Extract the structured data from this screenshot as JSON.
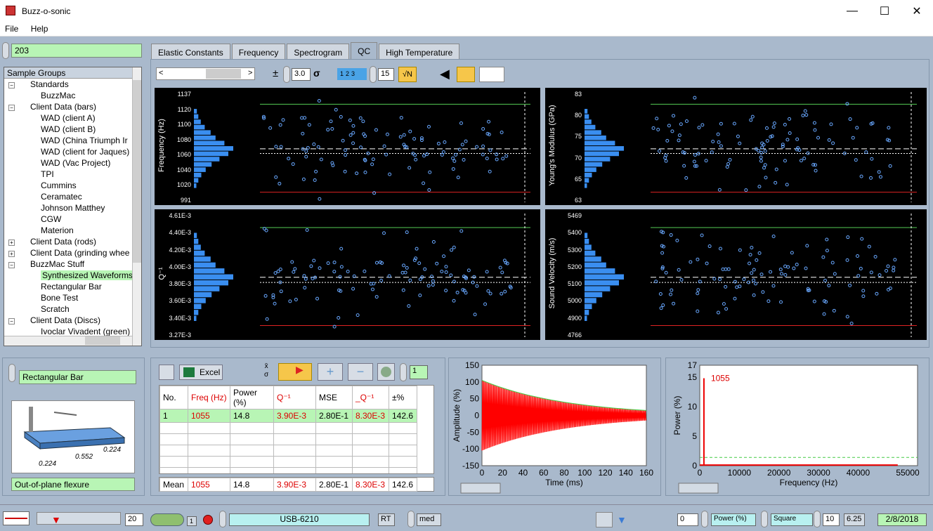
{
  "window": {
    "title": "Buzz-o-sonic",
    "minimize": "—",
    "maximize": "☐",
    "close": "✕"
  },
  "menu": [
    "File",
    "Help"
  ],
  "sample_id": "203",
  "tree": {
    "header": "Sample Groups",
    "rows": [
      {
        "label": "Standards",
        "level": 0,
        "exp": "−"
      },
      {
        "label": "BuzzMac",
        "level": 1
      },
      {
        "label": "Client Data (bars)",
        "level": 0,
        "exp": "−"
      },
      {
        "label": "WAD (client A)",
        "level": 1
      },
      {
        "label": "WAD (client B)",
        "level": 1
      },
      {
        "label": "WAD (China Triumph Ir",
        "level": 1
      },
      {
        "label": "WAD (client for Jaques)",
        "level": 1
      },
      {
        "label": "WAD (Vac Project)",
        "level": 1
      },
      {
        "label": "TPI",
        "level": 1
      },
      {
        "label": "Cummins",
        "level": 1
      },
      {
        "label": "Ceramatec",
        "level": 1
      },
      {
        "label": "Johnson Matthey",
        "level": 1
      },
      {
        "label": "CGW",
        "level": 1
      },
      {
        "label": "Materion",
        "level": 1
      },
      {
        "label": "Client Data (rods)",
        "level": 0,
        "exp": "+"
      },
      {
        "label": "Client Data (grinding whee",
        "level": 0,
        "exp": "+"
      },
      {
        "label": "BuzzMac Stuff",
        "level": 0,
        "exp": "−"
      },
      {
        "label": "Synthesized Waveforms",
        "level": 1,
        "selected": true
      },
      {
        "label": "Rectangular Bar",
        "level": 1
      },
      {
        "label": "Bone Test",
        "level": 1
      },
      {
        "label": "Scratch",
        "level": 1
      },
      {
        "label": "Client Data (Discs)",
        "level": 0,
        "exp": "−"
      },
      {
        "label": "Ivoclar Vivadent (green)",
        "level": 1
      }
    ]
  },
  "tabs": [
    "Elastic Constants",
    "Frequency",
    "Spectrogram",
    "QC",
    "High Temperature"
  ],
  "active_tab": "QC",
  "qc_toolbar": {
    "pm": "±",
    "sigma_value": "3.0",
    "sigma": "σ",
    "count": "15",
    "sqrtn": "√N",
    "bins": "123"
  },
  "qc_plots": [
    {
      "ylabel": "Frequency (Hz)",
      "ticks": [
        "1137",
        "1120",
        "1100",
        "1080",
        "1060",
        "1040",
        "1020",
        "991"
      ]
    },
    {
      "ylabel": "Young's Modulus (GPa)",
      "ticks": [
        "83",
        "80",
        "75",
        "70",
        "65",
        "63"
      ]
    },
    {
      "ylabel": "Q⁻¹",
      "ticks": [
        "4.61E-3",
        "4.40E-3",
        "4.20E-3",
        "4.00E-3",
        "3.80E-3",
        "3.60E-3",
        "3.40E-3",
        "3.27E-3"
      ]
    },
    {
      "ylabel": "Sound Velocity (m/s)",
      "ticks": [
        "5469",
        "5400",
        "5300",
        "5200",
        "5100",
        "5000",
        "4900",
        "4766"
      ]
    }
  ],
  "sample_shape": "Rectangular Bar",
  "mode": "Out-of-plane flexure",
  "dims": [
    "0.224",
    "0.552",
    "0.224"
  ],
  "excel_label": "Excel",
  "xbar_sigma": [
    "x̄",
    "σ"
  ],
  "spin_value": "1",
  "table": {
    "headers": [
      "No.",
      "Freq (Hz)",
      "Power (%)",
      "Q⁻¹",
      "MSE",
      "_Q⁻¹",
      "±%"
    ],
    "rows": [
      [
        "1",
        "1055",
        "14.8",
        "3.90E-3",
        "2.80E-1",
        "8.30E-3",
        "142.6"
      ]
    ],
    "mean": [
      "Mean",
      "1055",
      "14.8",
      "3.90E-3",
      "2.80E-1",
      "8.30E-3",
      "142.6"
    ]
  },
  "amp_chart": {
    "ylabel": "Amplitude (%)",
    "xlabel": "Time (ms)",
    "yticks": [
      "150",
      "100",
      "50",
      "0",
      "-50",
      "-100",
      "-150"
    ],
    "xticks": [
      "0",
      "20",
      "40",
      "60",
      "80",
      "100",
      "120",
      "140",
      "160"
    ]
  },
  "power_chart": {
    "ylabel": "Power (%)",
    "xlabel": "Frequency (Hz)",
    "yticks": [
      "17",
      "15",
      "10",
      "5",
      "0"
    ],
    "xticks": [
      "0",
      "10000",
      "20000",
      "30000",
      "40000",
      "55000"
    ],
    "peak_label": "1055"
  },
  "chart_data": [
    {
      "type": "line",
      "title": "",
      "xlabel": "Time (ms)",
      "ylabel": "Amplitude (%)",
      "xlim": [
        0,
        160
      ],
      "ylim": [
        -150,
        150
      ],
      "series": [
        {
          "envelope_start": 105,
          "envelope_end": 15
        }
      ]
    },
    {
      "type": "bar",
      "title": "",
      "xlabel": "Frequency (Hz)",
      "ylabel": "Power (%)",
      "xlim": [
        0,
        55000
      ],
      "ylim": [
        0,
        17
      ],
      "x": [
        1055
      ],
      "values": [
        14.8
      ]
    }
  ],
  "status": {
    "num1": "20",
    "num2": "1",
    "device": "USB-6210",
    "rt": "RT",
    "med": "med",
    "val0": "0",
    "power": "Power (%)",
    "square": "Square",
    "ten": "10",
    "six": "6.25",
    "date": "2/8/2018"
  }
}
